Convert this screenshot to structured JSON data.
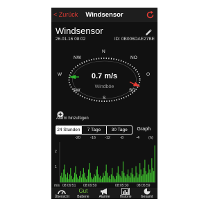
{
  "nav": {
    "back_label": "< Zurück",
    "title": "Windsensor"
  },
  "sensor": {
    "name": "Windsensor",
    "timestamp": "26.01.16  08:02",
    "id_label": "ID: 0B006DAE27BE"
  },
  "compass": {
    "directions": {
      "n": "N",
      "no": "NO",
      "o": "O",
      "so": "SO",
      "s": "S",
      "sw": "SW",
      "w": "W",
      "nw": "NW"
    },
    "wind_speed": "0.7 m/s",
    "gust_label": "Windböe",
    "wind_color": "#2fb52f",
    "gust_color": "#e23b34"
  },
  "alarm": {
    "add_label": "Alarm hinzufügen"
  },
  "range_tabs": [
    {
      "label": "24 Stunden",
      "active": true
    },
    {
      "label": "7 Tage",
      "active": false
    },
    {
      "label": "30 Tage",
      "active": false
    }
  ],
  "graph_label": "Graph",
  "time_ticks": [
    "-20",
    "-16",
    "-12",
    "-8",
    "-4",
    "(h)"
  ],
  "chart_data": {
    "type": "bar",
    "ylim": [
      0,
      2.5
    ],
    "yticks": [
      "2",
      "1"
    ],
    "xlabels": [
      "m/s",
      "08:09:51",
      "08:09:59",
      "08:05:30",
      "08:05:59"
    ],
    "series": [
      {
        "values": [
          0.4,
          0.6,
          0.3,
          0.8,
          1.1,
          0.5,
          0.3,
          0.6,
          0.2,
          0.5,
          0.9,
          0.4,
          0.2,
          0.3,
          0.6,
          1.0,
          0.5,
          0.3,
          0.2,
          0.4,
          0.7,
          0.3,
          0.5,
          0.9,
          0.6,
          0.3,
          0.2,
          0.4,
          0.8,
          1.2,
          0.6,
          0.3,
          0.2,
          0.3,
          0.5,
          0.4,
          0.8,
          1.0,
          0.5,
          0.3,
          0.4,
          0.2,
          0.3,
          0.6,
          0.4,
          0.7,
          1.1,
          0.6,
          0.3,
          0.4,
          0.2,
          0.5,
          0.9,
          0.4,
          0.3,
          0.2,
          0.4,
          0.6,
          1.0,
          0.5,
          0.4,
          0.3,
          0.7,
          1.3,
          0.6,
          0.4,
          0.3,
          0.5,
          0.8,
          0.4,
          0.3,
          0.6,
          0.9,
          0.5,
          0.3,
          0.4,
          1.0,
          0.6,
          0.3,
          0.5,
          1.2,
          0.8,
          0.4,
          0.5,
          0.9,
          1.4,
          0.7,
          0.5,
          0.6,
          1.1,
          0.8,
          0.6,
          1.5,
          0.9,
          0.7,
          2.3
        ]
      }
    ],
    "color": "#3fbf2e"
  },
  "tabbar": [
    {
      "label": "Übersicht",
      "icon": "gauge-icon"
    },
    {
      "label": "Batterie",
      "icon": "battery-status",
      "status": "Gut"
    },
    {
      "label": "Alarme",
      "icon": "megaphone-icon"
    },
    {
      "label": "Historie",
      "icon": "bar-chart-icon"
    },
    {
      "label": "Gesamt",
      "icon": "pie-chart-icon"
    }
  ]
}
